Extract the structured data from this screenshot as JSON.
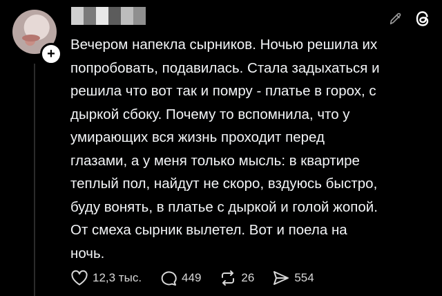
{
  "post": {
    "text": "Вечером напекла сырников. Ночью решила их\nпопробовать, подавилась. Стала задыхаться и\nрешила что вот так и помру - платье в горох, с\nдыркой сбоку. Почему то вспомнила, что у\nумирающих вся жизнь проходит перед\nглазами, а у меня только мысль: в квартире\nтеплый пол, найдут не скоро, вздуюсь быстро,\nбуду вонять, в платье с дыркой и голой жопой.\nОт смеха сырник вылетел. Вот и поела на\nночь."
  },
  "actions": {
    "likes": "12,3 тыс.",
    "replies": "449",
    "reposts": "26",
    "shares": "554"
  },
  "icons": {
    "like": "heart-icon",
    "reply": "speech-bubble-icon",
    "repost": "repost-arrows-icon",
    "share": "send-icon",
    "edit": "pencil-icon",
    "threads": "threads-logo-icon",
    "follow": "plus-icon"
  }
}
